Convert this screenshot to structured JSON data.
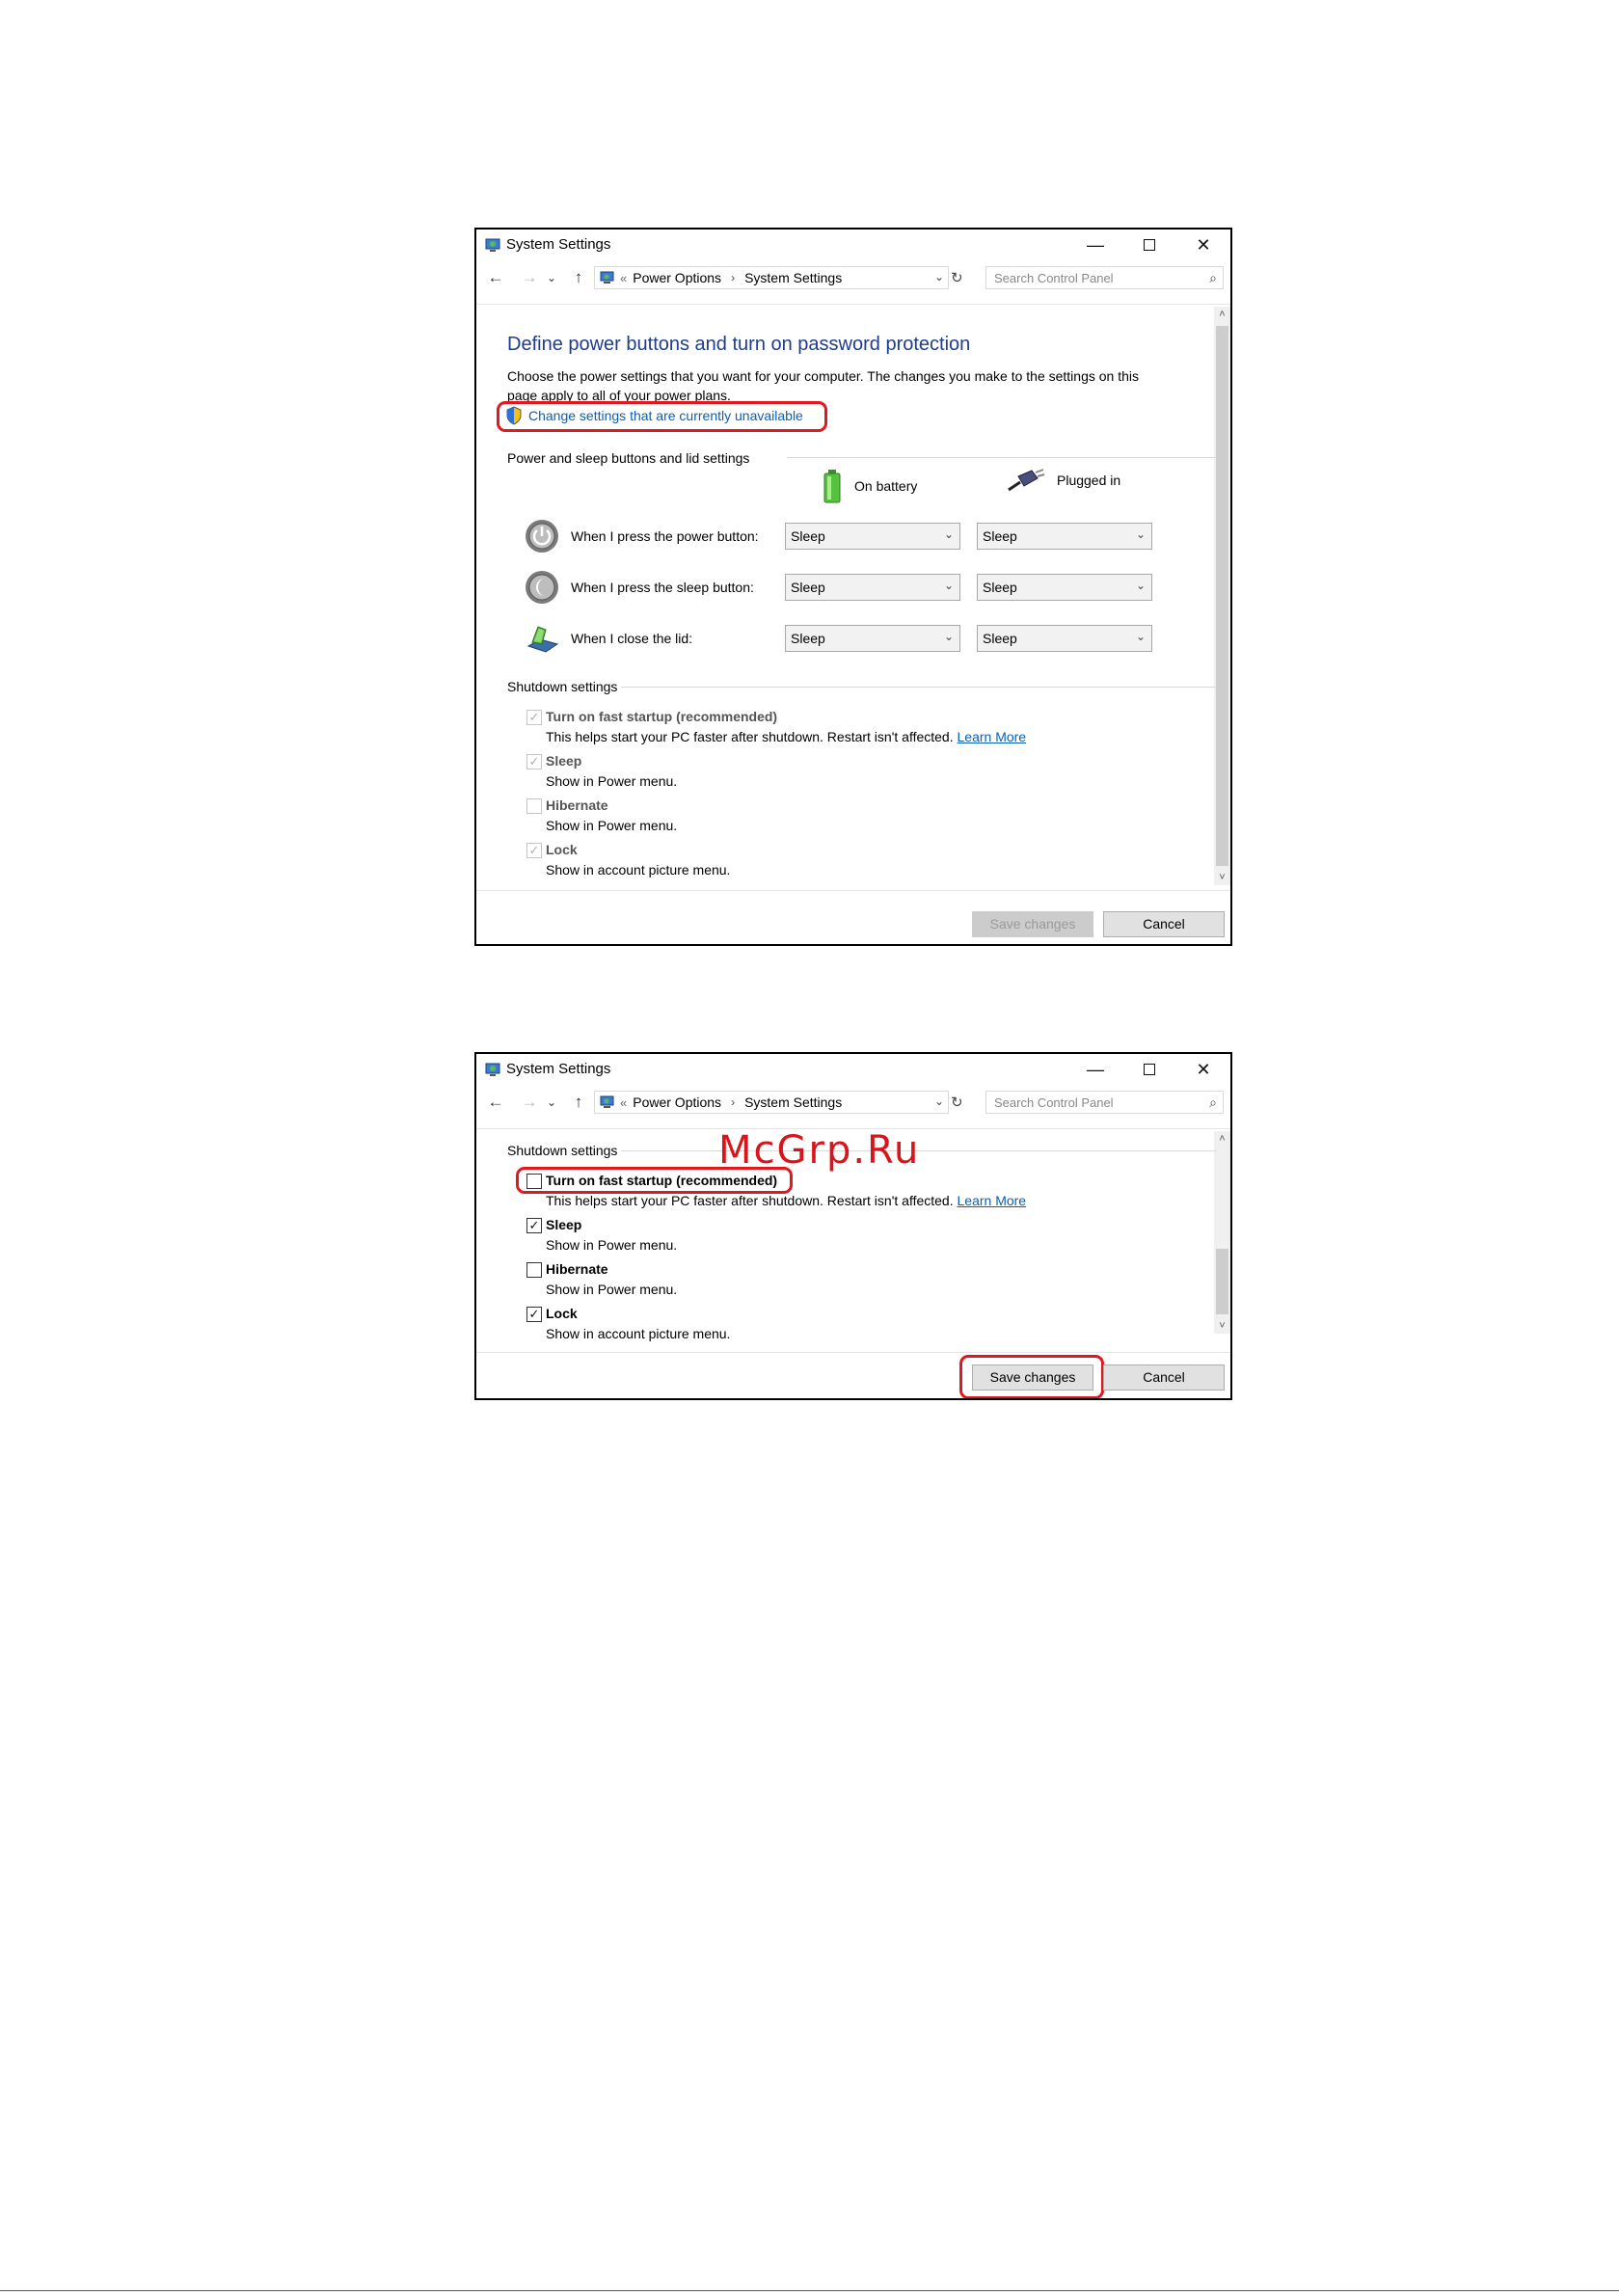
{
  "window": {
    "title": "System Settings",
    "minimize": "—",
    "maximize": "",
    "close": "✕"
  },
  "nav": {
    "back": "←",
    "forward": "→",
    "recent": "⌄",
    "up": "↑",
    "chevron": "«",
    "breadcrumb": [
      "Power Options",
      "System Settings"
    ],
    "separator": "›",
    "dropdown": "⌄",
    "refresh": "↻",
    "search_placeholder": "Search Control Panel",
    "search_icon": "⌕"
  },
  "page": {
    "heading": "Define power buttons and turn on password protection",
    "description": "Choose the power settings that you want for your computer. The changes you make to the settings on this page apply to all of your power plans.",
    "change_link": "Change settings that are currently unavailable"
  },
  "power_section": {
    "label": "Power and sleep buttons and lid settings",
    "columns": [
      "On battery",
      "Plugged in"
    ],
    "rows": [
      {
        "label": "When I press the power button:",
        "battery": "Sleep",
        "plugged": "Sleep",
        "icon": "power-button-icon"
      },
      {
        "label": "When I press the sleep button:",
        "battery": "Sleep",
        "plugged": "Sleep",
        "icon": "sleep-button-icon"
      },
      {
        "label": "When I close the lid:",
        "battery": "Sleep",
        "plugged": "Sleep",
        "icon": "laptop-lid-icon"
      }
    ]
  },
  "shutdown": {
    "label": "Shutdown settings",
    "learn_more": "Learn More",
    "options_before": [
      {
        "title": "Turn on fast startup (recommended)",
        "sub": "This helps start your PC faster after shutdown. Restart isn't affected.",
        "checked": true
      },
      {
        "title": "Sleep",
        "sub": "Show in Power menu.",
        "checked": true
      },
      {
        "title": "Hibernate",
        "sub": "Show in Power menu.",
        "checked": false
      },
      {
        "title": "Lock",
        "sub": "Show in account picture menu.",
        "checked": true
      }
    ],
    "options_after": [
      {
        "title": "Turn on fast startup (recommended)",
        "sub": "This helps start your PC faster after shutdown. Restart isn't affected.",
        "checked": false
      },
      {
        "title": "Sleep",
        "sub": "Show in Power menu.",
        "checked": true
      },
      {
        "title": "Hibernate",
        "sub": "Show in Power menu.",
        "checked": false
      },
      {
        "title": "Lock",
        "sub": "Show in account picture menu.",
        "checked": true
      }
    ]
  },
  "buttons": {
    "save": "Save changes",
    "cancel": "Cancel"
  },
  "check_mark": "✓",
  "scroll": {
    "up": "˄",
    "down": "˅"
  },
  "watermark": "McGrp.Ru",
  "colors": {
    "highlight": "#e1181e",
    "heading": "#1f3c8f",
    "link": "#0b5fb5"
  }
}
